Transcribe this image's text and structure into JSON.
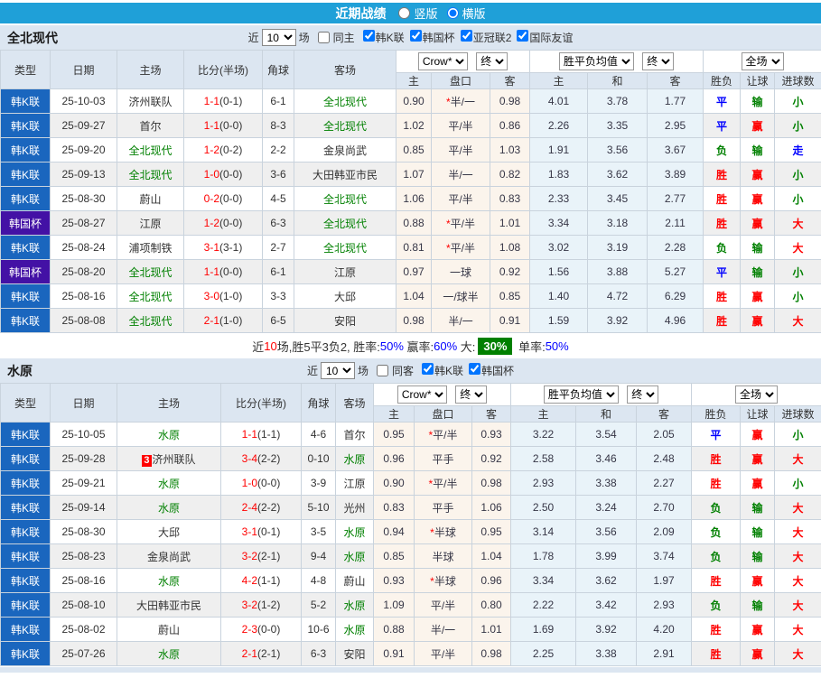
{
  "colors": {
    "topbar_blue": "#1FA0D8",
    "league_k_blue": "#1A66BE",
    "cup_purple": "#4311A5",
    "win_red": "#FF0000",
    "draw_blue": "#0000FF",
    "lose_green": "#008000",
    "big_rate_green_bg": "#008000",
    "asia_odds_bg": "#FBF4EC",
    "europe_odds_bg": "#E9F3F9"
  },
  "topbar": {
    "title": "近期战绩",
    "vertical_label": "竖版",
    "horizontal_label": "横版",
    "selected": "横版"
  },
  "header": {
    "type": "类型",
    "date": "日期",
    "home": "主场",
    "score_half": "比分(半场)",
    "corner": "角球",
    "away": "客场",
    "bookmaker": "Crow*",
    "final1": "终",
    "sub_home": "主",
    "sub_handicap": "盘口",
    "sub_away": "客",
    "avg_select": "胜平负均值",
    "final2": "终",
    "sub_eu_home": "主",
    "sub_eu_draw": "和",
    "sub_eu_away": "客",
    "full_select": "全场",
    "sub_wdl": "胜负",
    "sub_let": "让球",
    "sub_goals": "进球数"
  },
  "sections": [
    {
      "team": "全北现代",
      "filter": {
        "near_label": "近",
        "games_value": "10",
        "games_suffix": "场",
        "same_label": "同主",
        "same_checked": false,
        "leagues": [
          "韩K联",
          "韩国杯",
          "亚冠联2",
          "国际友谊"
        ]
      },
      "rows": [
        {
          "type": "韩K联",
          "cup": false,
          "date": "25-10-03",
          "home": "济州联队",
          "hg": false,
          "badge": "",
          "score": "1-1",
          "half": "(0-1)",
          "corner": "6-1",
          "away": "全北现代",
          "ag": true,
          "asia": [
            "0.90",
            "半/一",
            "0.98"
          ],
          "star": true,
          "eu": [
            "4.01",
            "3.78",
            "1.77"
          ],
          "res": [
            {
              "t": "平",
              "c": "blue"
            },
            {
              "t": "输",
              "c": "green"
            },
            {
              "t": "小",
              "c": "green"
            }
          ]
        },
        {
          "type": "韩K联",
          "cup": false,
          "date": "25-09-27",
          "home": "首尔",
          "hg": false,
          "badge": "",
          "score": "1-1",
          "half": "(0-0)",
          "corner": "8-3",
          "away": "全北现代",
          "ag": true,
          "asia": [
            "1.02",
            "平/半",
            "0.86"
          ],
          "star": false,
          "eu": [
            "2.26",
            "3.35",
            "2.95"
          ],
          "res": [
            {
              "t": "平",
              "c": "blue"
            },
            {
              "t": "赢",
              "c": "red"
            },
            {
              "t": "小",
              "c": "green"
            }
          ]
        },
        {
          "type": "韩K联",
          "cup": false,
          "date": "25-09-20",
          "home": "全北现代",
          "hg": true,
          "badge": "",
          "score": "1-2",
          "half": "(0-2)",
          "corner": "2-2",
          "away": "金泉尚武",
          "ag": false,
          "asia": [
            "0.85",
            "平/半",
            "1.03"
          ],
          "star": false,
          "eu": [
            "1.91",
            "3.56",
            "3.67"
          ],
          "res": [
            {
              "t": "负",
              "c": "green"
            },
            {
              "t": "输",
              "c": "green"
            },
            {
              "t": "走",
              "c": "blue"
            }
          ]
        },
        {
          "type": "韩K联",
          "cup": false,
          "date": "25-09-13",
          "home": "全北现代",
          "hg": true,
          "badge": "",
          "score": "1-0",
          "half": "(0-0)",
          "corner": "3-6",
          "away": "大田韩亚市民",
          "ag": false,
          "asia": [
            "1.07",
            "半/一",
            "0.82"
          ],
          "star": false,
          "eu": [
            "1.83",
            "3.62",
            "3.89"
          ],
          "res": [
            {
              "t": "胜",
              "c": "red"
            },
            {
              "t": "赢",
              "c": "red"
            },
            {
              "t": "小",
              "c": "green"
            }
          ]
        },
        {
          "type": "韩K联",
          "cup": false,
          "date": "25-08-30",
          "home": "蔚山",
          "hg": false,
          "badge": "",
          "score": "0-2",
          "half": "(0-0)",
          "corner": "4-5",
          "away": "全北现代",
          "ag": true,
          "asia": [
            "1.06",
            "平/半",
            "0.83"
          ],
          "star": false,
          "eu": [
            "2.33",
            "3.45",
            "2.77"
          ],
          "res": [
            {
              "t": "胜",
              "c": "red"
            },
            {
              "t": "赢",
              "c": "red"
            },
            {
              "t": "小",
              "c": "green"
            }
          ]
        },
        {
          "type": "韩国杯",
          "cup": true,
          "date": "25-08-27",
          "home": "江原",
          "hg": false,
          "badge": "",
          "score": "1-2",
          "half": "(0-0)",
          "corner": "6-3",
          "away": "全北现代",
          "ag": true,
          "asia": [
            "0.88",
            "平/半",
            "1.01"
          ],
          "star": true,
          "eu": [
            "3.34",
            "3.18",
            "2.11"
          ],
          "res": [
            {
              "t": "胜",
              "c": "red"
            },
            {
              "t": "赢",
              "c": "red"
            },
            {
              "t": "大",
              "c": "red"
            }
          ]
        },
        {
          "type": "韩K联",
          "cup": false,
          "date": "25-08-24",
          "home": "浦项制铁",
          "hg": false,
          "badge": "",
          "score": "3-1",
          "half": "(3-1)",
          "corner": "2-7",
          "away": "全北现代",
          "ag": true,
          "asia": [
            "0.81",
            "平/半",
            "1.08"
          ],
          "star": true,
          "eu": [
            "3.02",
            "3.19",
            "2.28"
          ],
          "res": [
            {
              "t": "负",
              "c": "green"
            },
            {
              "t": "输",
              "c": "green"
            },
            {
              "t": "大",
              "c": "red"
            }
          ]
        },
        {
          "type": "韩国杯",
          "cup": true,
          "date": "25-08-20",
          "home": "全北现代",
          "hg": true,
          "badge": "",
          "score": "1-1",
          "half": "(0-0)",
          "corner": "6-1",
          "away": "江原",
          "ag": false,
          "asia": [
            "0.97",
            "一球",
            "0.92"
          ],
          "star": false,
          "eu": [
            "1.56",
            "3.88",
            "5.27"
          ],
          "res": [
            {
              "t": "平",
              "c": "blue"
            },
            {
              "t": "输",
              "c": "green"
            },
            {
              "t": "小",
              "c": "green"
            }
          ]
        },
        {
          "type": "韩K联",
          "cup": false,
          "date": "25-08-16",
          "home": "全北现代",
          "hg": true,
          "badge": "",
          "score": "3-0",
          "half": "(1-0)",
          "corner": "3-3",
          "away": "大邱",
          "ag": false,
          "asia": [
            "1.04",
            "一/球半",
            "0.85"
          ],
          "star": false,
          "eu": [
            "1.40",
            "4.72",
            "6.29"
          ],
          "res": [
            {
              "t": "胜",
              "c": "red"
            },
            {
              "t": "赢",
              "c": "red"
            },
            {
              "t": "小",
              "c": "green"
            }
          ]
        },
        {
          "type": "韩K联",
          "cup": false,
          "date": "25-08-08",
          "home": "全北现代",
          "hg": true,
          "badge": "",
          "score": "2-1",
          "half": "(1-0)",
          "corner": "6-5",
          "away": "安阳",
          "ag": false,
          "asia": [
            "0.98",
            "半/一",
            "0.91"
          ],
          "star": false,
          "eu": [
            "1.59",
            "3.92",
            "4.96"
          ],
          "res": [
            {
              "t": "胜",
              "c": "red"
            },
            {
              "t": "赢",
              "c": "red"
            },
            {
              "t": "大",
              "c": "red"
            }
          ]
        }
      ],
      "summary": {
        "parts": [
          {
            "t": "近",
            "c": "dark"
          },
          {
            "t": "10",
            "c": "red"
          },
          {
            "t": "场,胜5平3负2, 胜率:",
            "c": "dark"
          },
          {
            "t": "50%",
            "c": "blue"
          },
          {
            "t": " 赢率:",
            "c": "dark"
          },
          {
            "t": "60%",
            "c": "blue"
          },
          {
            "t": " 大:",
            "c": "dark"
          },
          {
            "t": "30%",
            "c": "greenbox"
          },
          {
            "t": " 单率:",
            "c": "dark"
          },
          {
            "t": "50%",
            "c": "blue"
          }
        ]
      }
    },
    {
      "team": "水原",
      "filter": {
        "near_label": "近",
        "games_value": "10",
        "games_suffix": "场",
        "same_label": "同客",
        "same_checked": false,
        "leagues": [
          "韩K联",
          "韩国杯"
        ]
      },
      "rows": [
        {
          "type": "韩K联",
          "cup": false,
          "date": "25-10-05",
          "home": "水原",
          "hg": true,
          "badge": "",
          "score": "1-1",
          "half": "(1-1)",
          "corner": "4-6",
          "away": "首尔",
          "ag": false,
          "asia": [
            "0.95",
            "平/半",
            "0.93"
          ],
          "star": true,
          "eu": [
            "3.22",
            "3.54",
            "2.05"
          ],
          "res": [
            {
              "t": "平",
              "c": "blue"
            },
            {
              "t": "赢",
              "c": "red"
            },
            {
              "t": "小",
              "c": "green"
            }
          ]
        },
        {
          "type": "韩K联",
          "cup": false,
          "date": "25-09-28",
          "home": "济州联队",
          "hg": false,
          "badge": "3",
          "score": "3-4",
          "half": "(2-2)",
          "corner": "0-10",
          "away": "水原",
          "ag": true,
          "asia": [
            "0.96",
            "平手",
            "0.92"
          ],
          "star": false,
          "eu": [
            "2.58",
            "3.46",
            "2.48"
          ],
          "res": [
            {
              "t": "胜",
              "c": "red"
            },
            {
              "t": "赢",
              "c": "red"
            },
            {
              "t": "大",
              "c": "red"
            }
          ]
        },
        {
          "type": "韩K联",
          "cup": false,
          "date": "25-09-21",
          "home": "水原",
          "hg": true,
          "badge": "",
          "score": "1-0",
          "half": "(0-0)",
          "corner": "3-9",
          "away": "江原",
          "ag": false,
          "asia": [
            "0.90",
            "平/半",
            "0.98"
          ],
          "star": true,
          "eu": [
            "2.93",
            "3.38",
            "2.27"
          ],
          "res": [
            {
              "t": "胜",
              "c": "red"
            },
            {
              "t": "赢",
              "c": "red"
            },
            {
              "t": "小",
              "c": "green"
            }
          ]
        },
        {
          "type": "韩K联",
          "cup": false,
          "date": "25-09-14",
          "home": "水原",
          "hg": true,
          "badge": "",
          "score": "2-4",
          "half": "(2-2)",
          "corner": "5-10",
          "away": "光州",
          "ag": false,
          "asia": [
            "0.83",
            "平手",
            "1.06"
          ],
          "star": false,
          "eu": [
            "2.50",
            "3.24",
            "2.70"
          ],
          "res": [
            {
              "t": "负",
              "c": "green"
            },
            {
              "t": "输",
              "c": "green"
            },
            {
              "t": "大",
              "c": "red"
            }
          ]
        },
        {
          "type": "韩K联",
          "cup": false,
          "date": "25-08-30",
          "home": "大邱",
          "hg": false,
          "badge": "",
          "score": "3-1",
          "half": "(0-1)",
          "corner": "3-5",
          "away": "水原",
          "ag": true,
          "asia": [
            "0.94",
            "半球",
            "0.95"
          ],
          "star": true,
          "eu": [
            "3.14",
            "3.56",
            "2.09"
          ],
          "res": [
            {
              "t": "负",
              "c": "green"
            },
            {
              "t": "输",
              "c": "green"
            },
            {
              "t": "大",
              "c": "red"
            }
          ]
        },
        {
          "type": "韩K联",
          "cup": false,
          "date": "25-08-23",
          "home": "金泉尚武",
          "hg": false,
          "badge": "",
          "score": "3-2",
          "half": "(2-1)",
          "corner": "9-4",
          "away": "水原",
          "ag": true,
          "asia": [
            "0.85",
            "半球",
            "1.04"
          ],
          "star": false,
          "eu": [
            "1.78",
            "3.99",
            "3.74"
          ],
          "res": [
            {
              "t": "负",
              "c": "green"
            },
            {
              "t": "输",
              "c": "green"
            },
            {
              "t": "大",
              "c": "red"
            }
          ]
        },
        {
          "type": "韩K联",
          "cup": false,
          "date": "25-08-16",
          "home": "水原",
          "hg": true,
          "badge": "",
          "score": "4-2",
          "half": "(1-1)",
          "corner": "4-8",
          "away": "蔚山",
          "ag": false,
          "asia": [
            "0.93",
            "半球",
            "0.96"
          ],
          "star": true,
          "eu": [
            "3.34",
            "3.62",
            "1.97"
          ],
          "res": [
            {
              "t": "胜",
              "c": "red"
            },
            {
              "t": "赢",
              "c": "red"
            },
            {
              "t": "大",
              "c": "red"
            }
          ]
        },
        {
          "type": "韩K联",
          "cup": false,
          "date": "25-08-10",
          "home": "大田韩亚市民",
          "hg": false,
          "badge": "",
          "score": "3-2",
          "half": "(1-2)",
          "corner": "5-2",
          "away": "水原",
          "ag": true,
          "asia": [
            "1.09",
            "平/半",
            "0.80"
          ],
          "star": false,
          "eu": [
            "2.22",
            "3.42",
            "2.93"
          ],
          "res": [
            {
              "t": "负",
              "c": "green"
            },
            {
              "t": "输",
              "c": "green"
            },
            {
              "t": "大",
              "c": "red"
            }
          ]
        },
        {
          "type": "韩K联",
          "cup": false,
          "date": "25-08-02",
          "home": "蔚山",
          "hg": false,
          "badge": "",
          "score": "2-3",
          "half": "(0-0)",
          "corner": "10-6",
          "away": "水原",
          "ag": true,
          "asia": [
            "0.88",
            "半/一",
            "1.01"
          ],
          "star": false,
          "eu": [
            "1.69",
            "3.92",
            "4.20"
          ],
          "res": [
            {
              "t": "胜",
              "c": "red"
            },
            {
              "t": "赢",
              "c": "red"
            },
            {
              "t": "大",
              "c": "red"
            }
          ]
        },
        {
          "type": "韩K联",
          "cup": false,
          "date": "25-07-26",
          "home": "水原",
          "hg": true,
          "badge": "",
          "score": "2-1",
          "half": "(2-1)",
          "corner": "6-3",
          "away": "安阳",
          "ag": false,
          "asia": [
            "0.91",
            "平/半",
            "0.98"
          ],
          "star": false,
          "eu": [
            "2.25",
            "3.38",
            "2.91"
          ],
          "res": [
            {
              "t": "胜",
              "c": "red"
            },
            {
              "t": "赢",
              "c": "red"
            },
            {
              "t": "大",
              "c": "red"
            }
          ]
        }
      ],
      "summary": null
    }
  ]
}
